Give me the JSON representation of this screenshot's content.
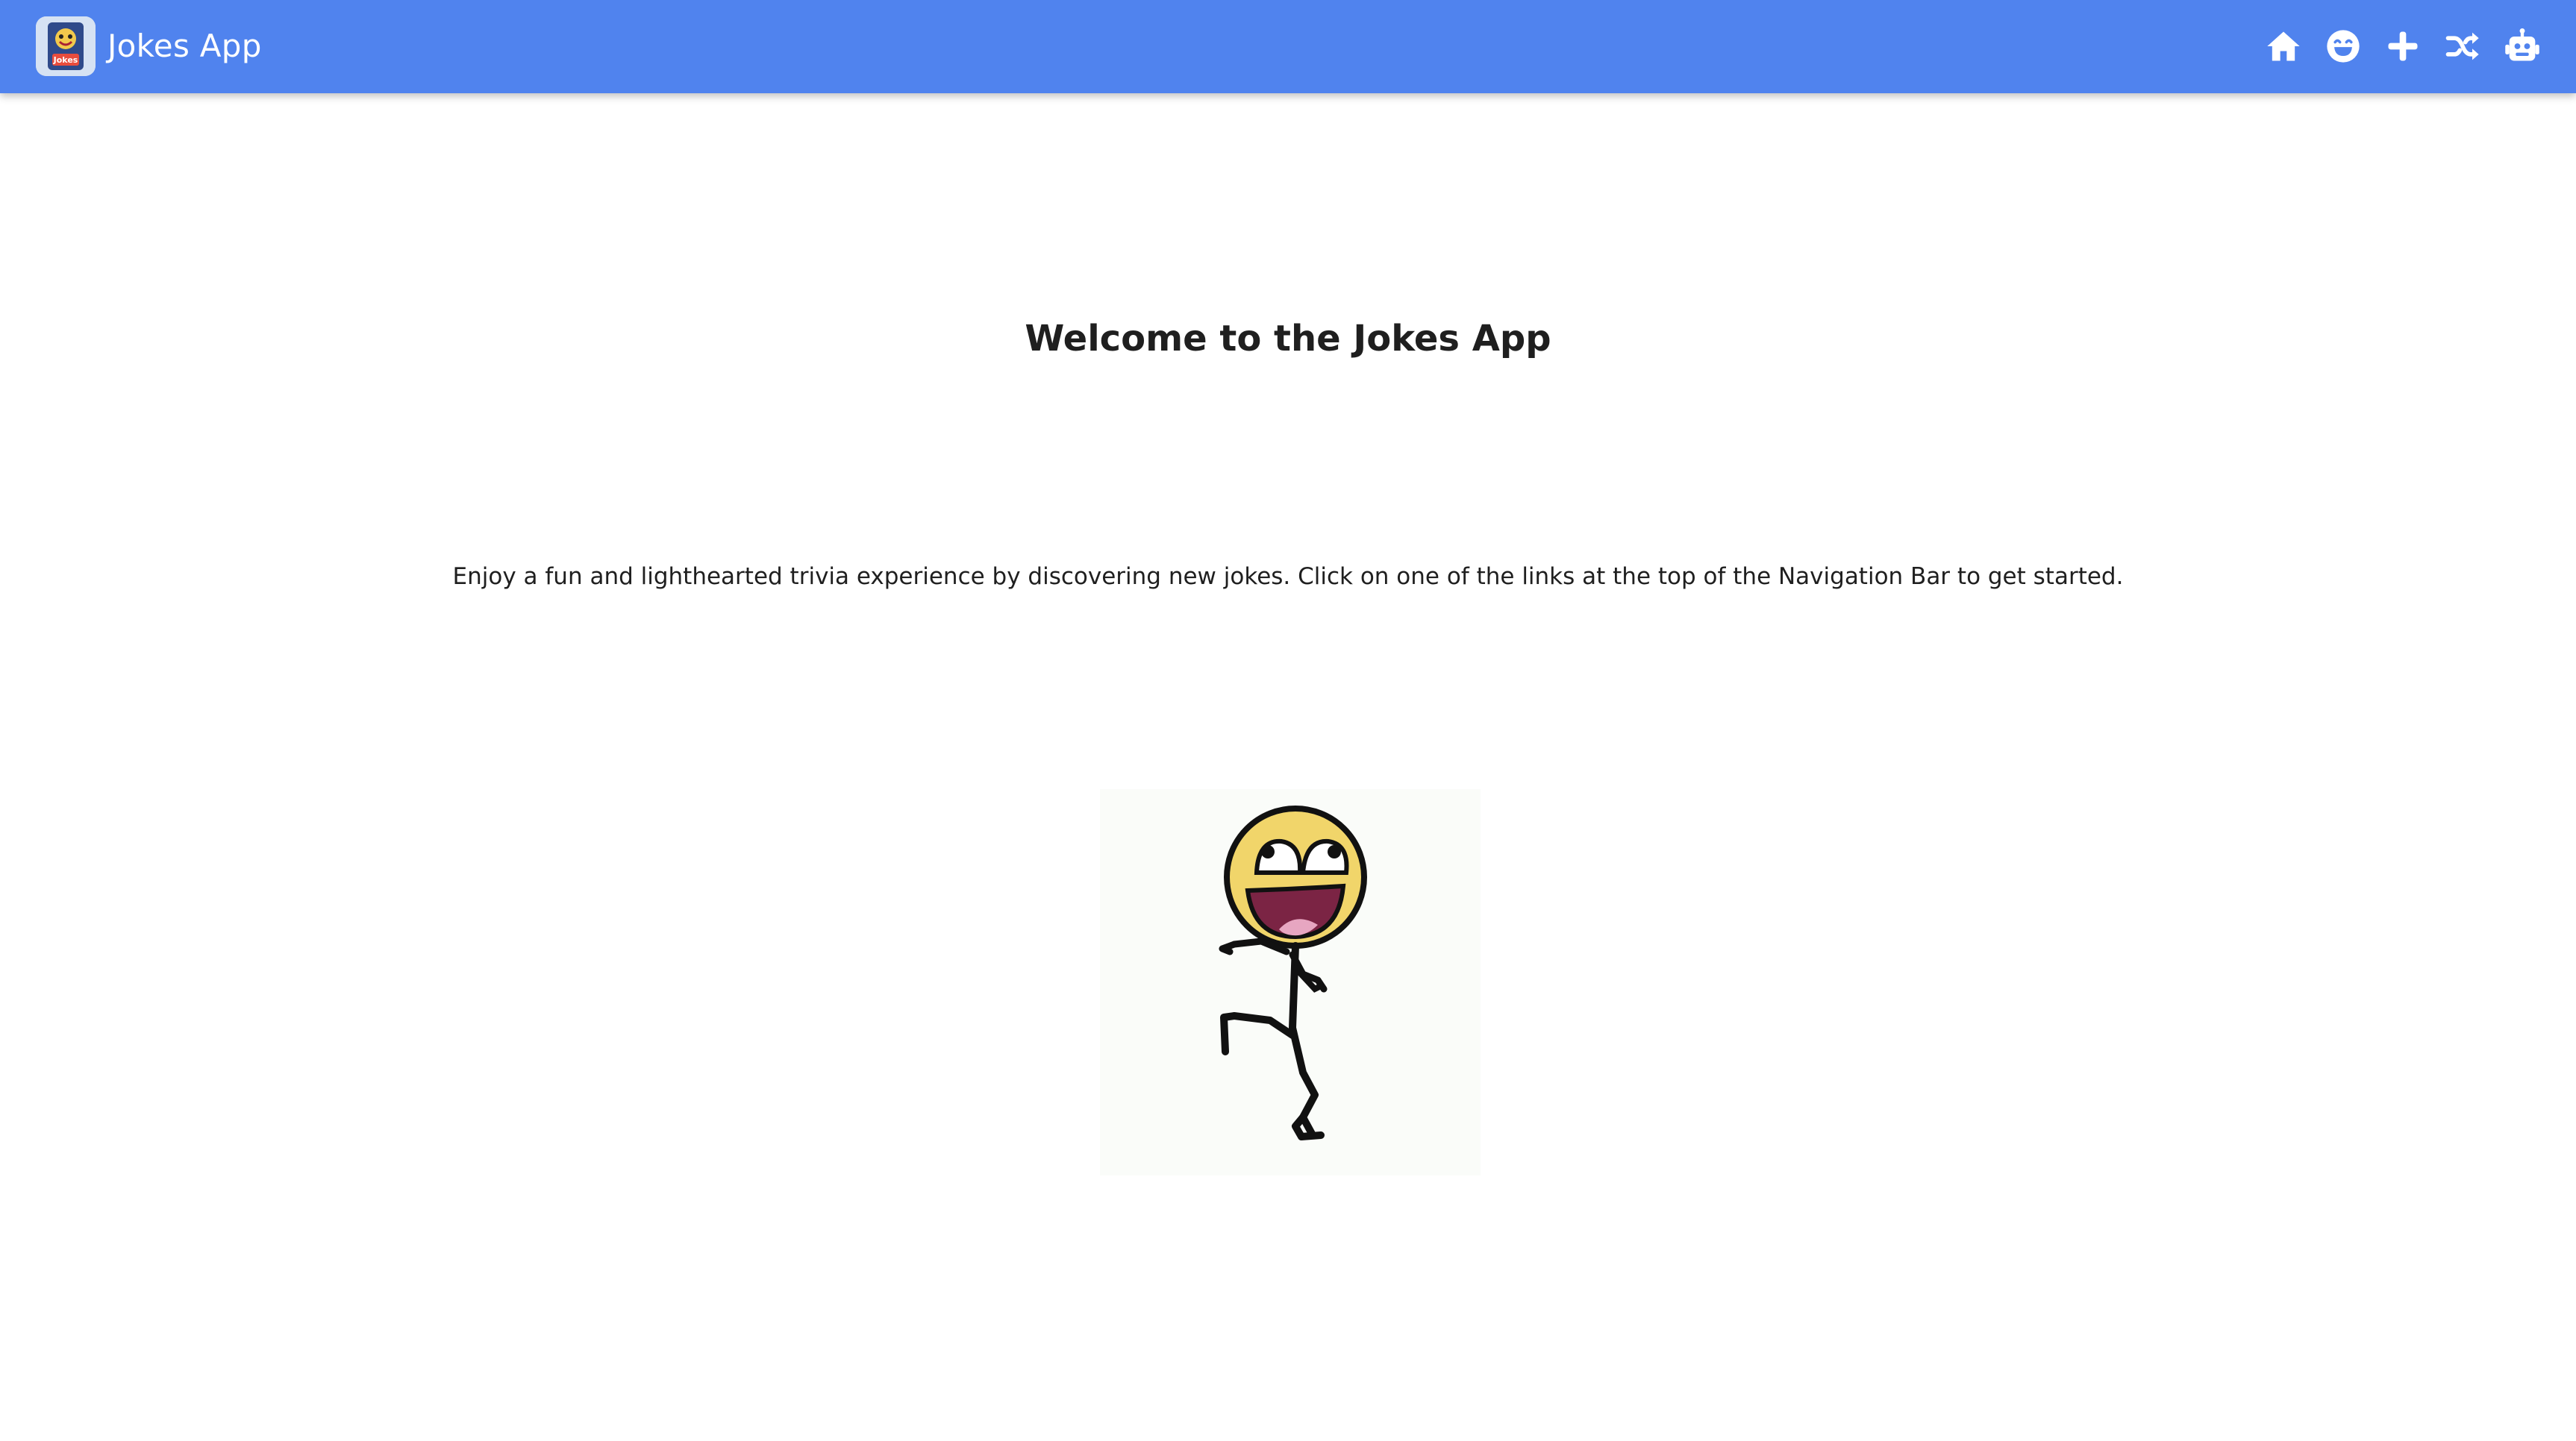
{
  "app": {
    "title": "Jokes App",
    "logo_text": "Jokes",
    "brand_color": "#5083ee"
  },
  "nav": {
    "items": [
      {
        "icon": "home-icon"
      },
      {
        "icon": "laugh-icon"
      },
      {
        "icon": "plus-icon"
      },
      {
        "icon": "shuffle-icon"
      },
      {
        "icon": "robot-icon"
      }
    ]
  },
  "main": {
    "heading": "Welcome to the Jokes App",
    "intro": "Enjoy a fun and lighthearted trivia experience by discovering new jokes. Click on one of the links at the top of the Navigation Bar to get started.",
    "illustration": "awesome-face-stick-figure"
  }
}
